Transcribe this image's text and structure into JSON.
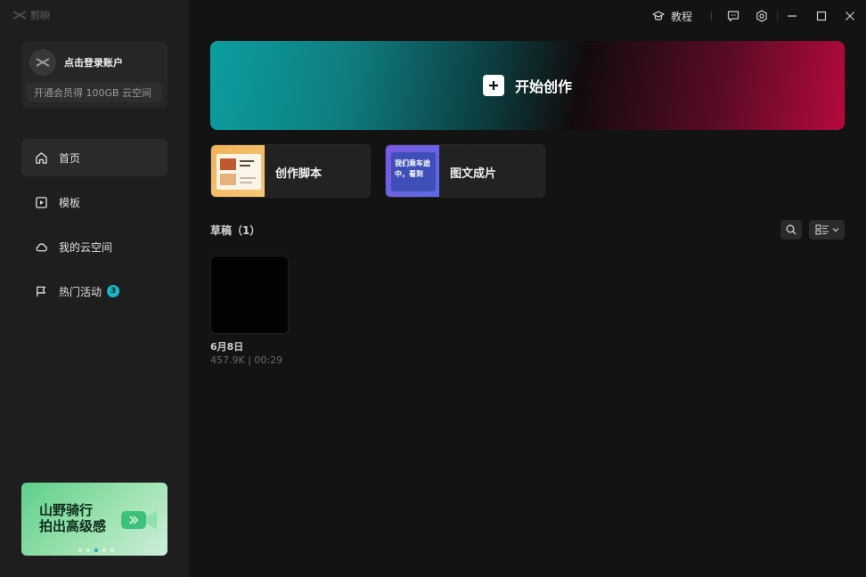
{
  "app": {
    "name": "剪映"
  },
  "account": {
    "login_text": "点击登录账户",
    "vip_text": "开通会员得 100GB 云空间"
  },
  "nav": [
    {
      "label": "首页",
      "icon": "home-icon",
      "active": true
    },
    {
      "label": "模板",
      "icon": "template-icon",
      "active": false
    },
    {
      "label": "我的云空间",
      "icon": "cloud-icon",
      "active": false
    },
    {
      "label": "热门活动",
      "icon": "flag-icon",
      "active": false,
      "badge": "3"
    }
  ],
  "promo": {
    "line1": "山野骑行",
    "line2": "拍出高级感",
    "slides": 5,
    "active_slide": 3
  },
  "topbar": {
    "tutorial_label": "教程"
  },
  "start": {
    "label": "开始创作"
  },
  "tools": [
    {
      "label": "创作脚本",
      "thumb_text": ""
    },
    {
      "label": "图文成片",
      "thumb_text": "我们乘车途中，看到"
    }
  ],
  "drafts": {
    "title": "草稿（1）",
    "items": [
      {
        "name": "6月8日",
        "meta": "457.9K | 00:29"
      }
    ]
  },
  "colors": {
    "badge": "#15b8c4",
    "banner_left": "#0b9ea0",
    "banner_right": "#b50a3d"
  }
}
